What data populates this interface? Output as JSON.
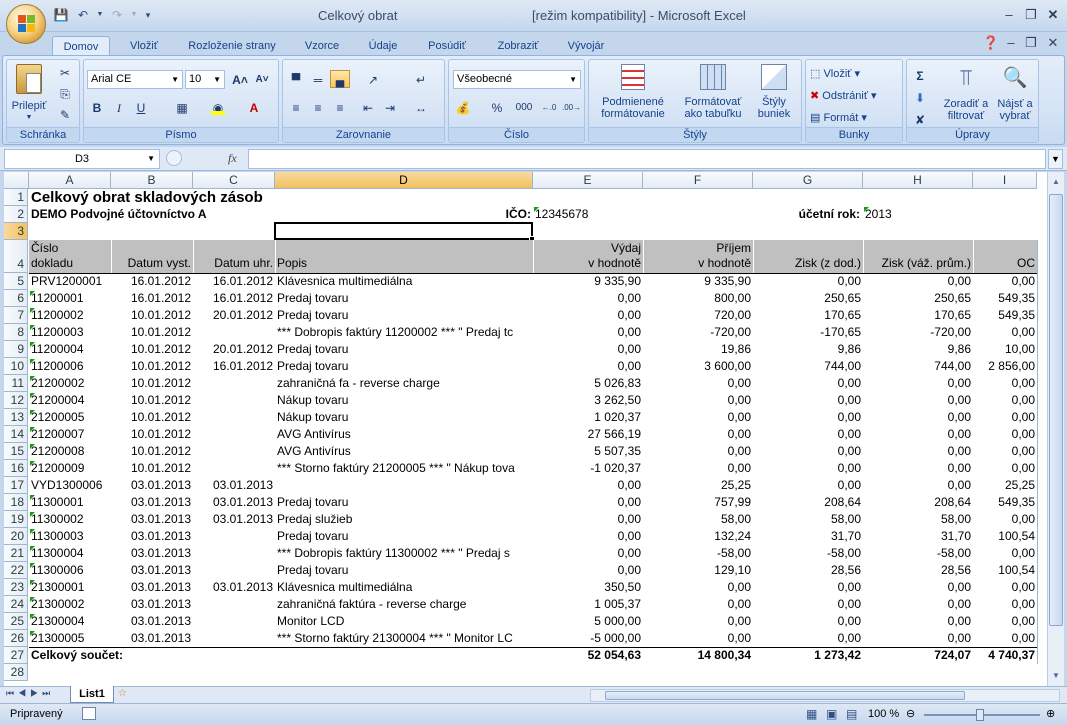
{
  "window": {
    "title": "Celkový obrat",
    "mode": "[režim kompatibility] - Microsoft Excel"
  },
  "ribbon_tabs": [
    "Domov",
    "Vložiť",
    "Rozloženie strany",
    "Vzorce",
    "Údaje",
    "Posúdiť",
    "Zobraziť",
    "Vývojár"
  ],
  "ribbon": {
    "clipboard": {
      "paste": "Prilepiť",
      "label": "Schránka"
    },
    "font": {
      "name": "Arial CE",
      "size": "10",
      "label": "Písmo"
    },
    "alignment": {
      "label": "Zarovnanie"
    },
    "number": {
      "format": "Všeobecné",
      "percent": "%",
      "thousands": "000",
      "label": "Číslo"
    },
    "styles": {
      "cond1": "Podmienené",
      "cond2": "formátovanie",
      "table1": "Formátovať",
      "table2": "ako tabuľku",
      "cell1": "Štýly",
      "cell2": "buniek",
      "label": "Štýly"
    },
    "cells": {
      "insert": "Vložiť",
      "delete": "Odstrániť",
      "format": "Formát",
      "label": "Bunky"
    },
    "editing": {
      "sort1": "Zoradiť a",
      "sort2": "filtrovať",
      "find1": "Nájsť a",
      "find2": "vybrať",
      "label": "Úpravy"
    }
  },
  "formula_bar": {
    "name_box": "D3",
    "fx": "fx",
    "formula": ""
  },
  "columns": [
    "A",
    "B",
    "C",
    "D",
    "E",
    "F",
    "G",
    "H",
    "I"
  ],
  "sheet": {
    "title": "Celkový obrat skladových zásob",
    "company": "DEMO Podvojné účtovníctvo A",
    "ico_label": "IČO:",
    "ico": "12345678",
    "year_label": "účetní rok:",
    "year": "2013",
    "headers": {
      "a1": "Číslo",
      "a2": "dokladu",
      "b": "Datum vyst.",
      "c": "Datum uhr.",
      "d": "Popis",
      "e1": "Výdaj",
      "e2": "v hodnotě",
      "f1": "Příjem",
      "f2": "v hodnotě",
      "g": "Zisk (z dod.)",
      "h": "Zisk (váž. prům.)",
      "i": "OC"
    },
    "rows": [
      {
        "n": "5",
        "a": "PRV1200001",
        "b": "16.01.2012",
        "c": "16.01.2012",
        "d": "Klávesnica multimediálna",
        "e": "9 335,90",
        "f": "9 335,90",
        "g": "0,00",
        "h": "0,00",
        "i": "0,00"
      },
      {
        "n": "6",
        "a": "11200001",
        "b": "16.01.2012",
        "c": "16.01.2012",
        "d": "Predaj tovaru",
        "e": "0,00",
        "f": "800,00",
        "g": "250,65",
        "h": "250,65",
        "i": "549,35"
      },
      {
        "n": "7",
        "a": "11200002",
        "b": "10.01.2012",
        "c": "20.01.2012",
        "d": "Predaj tovaru",
        "e": "0,00",
        "f": "720,00",
        "g": "170,65",
        "h": "170,65",
        "i": "549,35"
      },
      {
        "n": "8",
        "a": "11200003",
        "b": "10.01.2012",
        "c": "",
        "d": "*** Dobropis faktúry 11200002 *** \" Predaj tc",
        "e": "0,00",
        "f": "-720,00",
        "g": "-170,65",
        "h": "-720,00",
        "i": "0,00"
      },
      {
        "n": "9",
        "a": "11200004",
        "b": "10.01.2012",
        "c": "20.01.2012",
        "d": "Predaj tovaru",
        "e": "0,00",
        "f": "19,86",
        "g": "9,86",
        "h": "9,86",
        "i": "10,00"
      },
      {
        "n": "10",
        "a": "11200006",
        "b": "10.01.2012",
        "c": "16.01.2012",
        "d": "Predaj tovaru",
        "e": "0,00",
        "f": "3 600,00",
        "g": "744,00",
        "h": "744,00",
        "i": "2 856,00"
      },
      {
        "n": "11",
        "a": "21200002",
        "b": "10.01.2012",
        "c": "",
        "d": "zahraničná fa - reverse charge",
        "e": "5 026,83",
        "f": "0,00",
        "g": "0,00",
        "h": "0,00",
        "i": "0,00"
      },
      {
        "n": "12",
        "a": "21200004",
        "b": "10.01.2012",
        "c": "",
        "d": "Nákup tovaru",
        "e": "3 262,50",
        "f": "0,00",
        "g": "0,00",
        "h": "0,00",
        "i": "0,00"
      },
      {
        "n": "13",
        "a": "21200005",
        "b": "10.01.2012",
        "c": "",
        "d": "Nákup tovaru",
        "e": "1 020,37",
        "f": "0,00",
        "g": "0,00",
        "h": "0,00",
        "i": "0,00"
      },
      {
        "n": "14",
        "a": "21200007",
        "b": "10.01.2012",
        "c": "",
        "d": "AVG Antivírus",
        "e": "27 566,19",
        "f": "0,00",
        "g": "0,00",
        "h": "0,00",
        "i": "0,00"
      },
      {
        "n": "15",
        "a": "21200008",
        "b": "10.01.2012",
        "c": "",
        "d": "AVG Antivírus",
        "e": "5 507,35",
        "f": "0,00",
        "g": "0,00",
        "h": "0,00",
        "i": "0,00"
      },
      {
        "n": "16",
        "a": "21200009",
        "b": "10.01.2012",
        "c": "",
        "d": "*** Storno faktúry 21200005 *** \" Nákup tova",
        "e": "-1 020,37",
        "f": "0,00",
        "g": "0,00",
        "h": "0,00",
        "i": "0,00"
      },
      {
        "n": "17",
        "a": "VYD1300006",
        "b": "03.01.2013",
        "c": "03.01.2013",
        "d": "",
        "e": "0,00",
        "f": "25,25",
        "g": "0,00",
        "h": "0,00",
        "i": "25,25"
      },
      {
        "n": "18",
        "a": "11300001",
        "b": "03.01.2013",
        "c": "03.01.2013",
        "d": "Predaj tovaru",
        "e": "0,00",
        "f": "757,99",
        "g": "208,64",
        "h": "208,64",
        "i": "549,35"
      },
      {
        "n": "19",
        "a": "11300002",
        "b": "03.01.2013",
        "c": "03.01.2013",
        "d": "Predaj služieb",
        "e": "0,00",
        "f": "58,00",
        "g": "58,00",
        "h": "58,00",
        "i": "0,00"
      },
      {
        "n": "20",
        "a": "11300003",
        "b": "03.01.2013",
        "c": "",
        "d": "Predaj tovaru",
        "e": "0,00",
        "f": "132,24",
        "g": "31,70",
        "h": "31,70",
        "i": "100,54"
      },
      {
        "n": "21",
        "a": "11300004",
        "b": "03.01.2013",
        "c": "",
        "d": "*** Dobropis faktúry 11300002 *** \" Predaj s",
        "e": "0,00",
        "f": "-58,00",
        "g": "-58,00",
        "h": "-58,00",
        "i": "0,00"
      },
      {
        "n": "22",
        "a": "11300006",
        "b": "03.01.2013",
        "c": "",
        "d": "Predaj tovaru",
        "e": "0,00",
        "f": "129,10",
        "g": "28,56",
        "h": "28,56",
        "i": "100,54"
      },
      {
        "n": "23",
        "a": "21300001",
        "b": "03.01.2013",
        "c": "03.01.2013",
        "d": "Klávesnica multimediálna",
        "e": "350,50",
        "f": "0,00",
        "g": "0,00",
        "h": "0,00",
        "i": "0,00"
      },
      {
        "n": "24",
        "a": "21300002",
        "b": "03.01.2013",
        "c": "",
        "d": "zahraničná faktúra - reverse charge",
        "e": "1 005,37",
        "f": "0,00",
        "g": "0,00",
        "h": "0,00",
        "i": "0,00"
      },
      {
        "n": "25",
        "a": "21300004",
        "b": "03.01.2013",
        "c": "",
        "d": "Monitor LCD",
        "e": "5 000,00",
        "f": "0,00",
        "g": "0,00",
        "h": "0,00",
        "i": "0,00"
      },
      {
        "n": "26",
        "a": "21300005",
        "b": "03.01.2013",
        "c": "",
        "d": "*** Storno faktúry 21300004 *** \" Monitor LC",
        "e": "-5 000,00",
        "f": "0,00",
        "g": "0,00",
        "h": "0,00",
        "i": "0,00"
      }
    ],
    "total": {
      "label": "Celkový součet:",
      "e": "52 054,63",
      "f": "14 800,34",
      "g": "1 273,42",
      "h": "724,07",
      "i": "4 740,37"
    },
    "row_numbers": [
      "1",
      "2",
      "3",
      "4",
      "27",
      "28"
    ]
  },
  "sheet_tabs": [
    "List1"
  ],
  "status": {
    "ready": "Pripravený",
    "zoom": "100 %"
  }
}
